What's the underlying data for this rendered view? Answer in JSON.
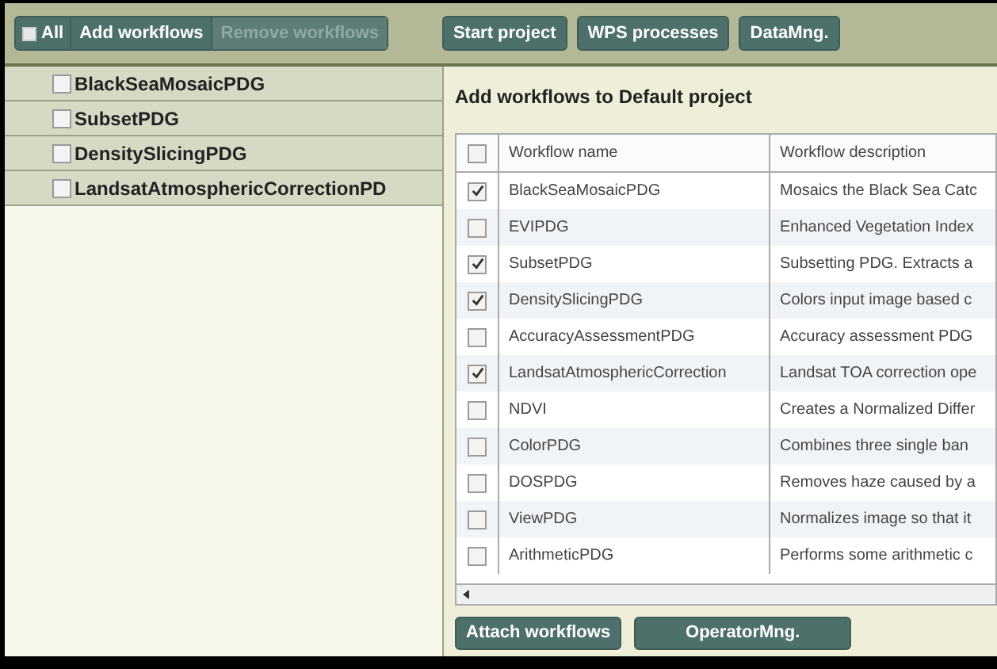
{
  "toolbar": {
    "all": {
      "label": "All",
      "checked": false
    },
    "buttons": [
      {
        "label": "Add workflows",
        "disabled": false
      },
      {
        "label": "Remove workflows",
        "disabled": true
      }
    ],
    "actions": [
      "Start project",
      "WPS processes",
      "DataMng."
    ]
  },
  "sidebar": {
    "items": [
      {
        "label": "BlackSeaMosaicPDG",
        "checked": false
      },
      {
        "label": "SubsetPDG",
        "checked": false
      },
      {
        "label": "DensitySlicingPDG",
        "checked": false
      },
      {
        "label": "LandsatAtmosphericCorrectionPD",
        "checked": false
      }
    ]
  },
  "panel": {
    "title": "Add workflows to Default project",
    "table": {
      "header_checked": false,
      "columns": [
        "Workflow name",
        "Workflow description"
      ],
      "rows": [
        {
          "checked": true,
          "name": "BlackSeaMosaicPDG",
          "description": "Mosaics the Black Sea Catc"
        },
        {
          "checked": false,
          "name": "EVIPDG",
          "description": "Enhanced Vegetation Index"
        },
        {
          "checked": true,
          "name": "SubsetPDG",
          "description": "Subsetting PDG. Extracts a"
        },
        {
          "checked": true,
          "name": "DensitySlicingPDG",
          "description": "Colors input image based c"
        },
        {
          "checked": false,
          "name": "AccuracyAssessmentPDG",
          "description": "Accuracy assessment PDG"
        },
        {
          "checked": true,
          "name": "LandsatAtmosphericCorrection",
          "description": "Landsat TOA correction ope"
        },
        {
          "checked": false,
          "name": "NDVI",
          "description": "Creates a Normalized Differ"
        },
        {
          "checked": false,
          "name": "ColorPDG",
          "description": "Combines three single ban"
        },
        {
          "checked": false,
          "name": "DOSPDG",
          "description": "Removes haze caused by a"
        },
        {
          "checked": false,
          "name": "ViewPDG",
          "description": "Normalizes image so that it"
        },
        {
          "checked": false,
          "name": "ArithmeticPDG",
          "description": "Performs some arithmetic c"
        }
      ]
    },
    "buttons": [
      "Attach workflows",
      "OperatorMng."
    ]
  }
}
